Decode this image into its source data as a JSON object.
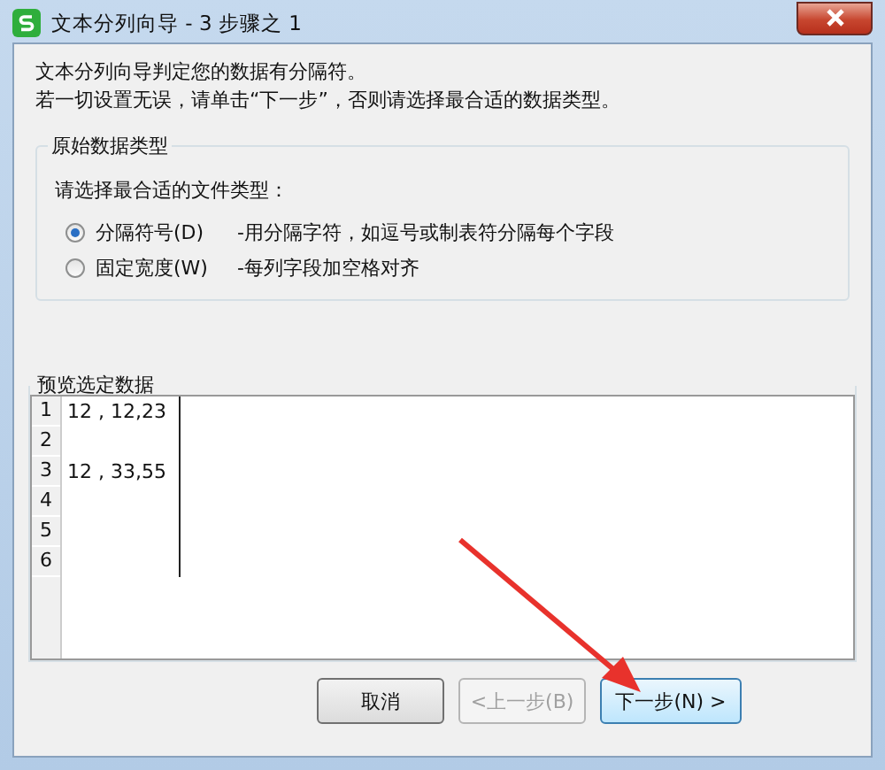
{
  "window": {
    "title": "文本分列向导 - 3 步骤之 1"
  },
  "intro": [
    "文本分列向导判定您的数据有分隔符。",
    "若一切设置无误，请单击“下一步”，否则请选择最合适的数据类型。"
  ],
  "group": {
    "title": "原始数据类型",
    "prompt": "请选择最合适的文件类型：",
    "options": [
      {
        "label": "分隔符号(D)",
        "description": "-用分隔字符，如逗号或制表符分隔每个字段",
        "selected": true
      },
      {
        "label": "固定宽度(W)",
        "description": "-每列字段加空格对齐",
        "selected": false
      }
    ]
  },
  "preview": {
    "title": "预览选定数据",
    "rows": [
      {
        "number": "1",
        "text": "12 , 12,23"
      },
      {
        "number": "2"
      },
      {
        "number": "3",
        "text": "12 , 33,55"
      },
      {
        "number": "4"
      },
      {
        "number": "5"
      },
      {
        "number": "6"
      }
    ]
  },
  "buttons": [
    {
      "label": "取消",
      "disabled": false,
      "focused": false
    },
    {
      "label": "<上一步(B)",
      "disabled": true,
      "focused": false
    },
    {
      "label": "下一步(N) >",
      "disabled": false,
      "focused": true
    }
  ]
}
